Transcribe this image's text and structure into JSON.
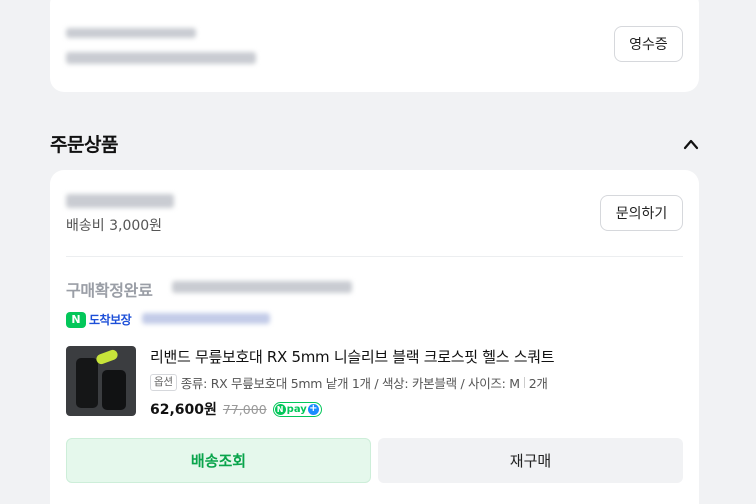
{
  "receipt_card": {
    "receipt_button": "영수증"
  },
  "section": {
    "title": "주문상품"
  },
  "order": {
    "shipping_fee": "배송비 3,000원",
    "inquiry_button": "문의하기",
    "status": "구매확정완료",
    "delivery_badge": {
      "n_mark": "N",
      "label": "도착보장"
    },
    "product": {
      "name": "리밴드 무릎보호대 RX 5mm 니슬리브 블랙 크로스핏 헬스 스쿼트",
      "option_tag": "옵션",
      "option_text": "종류: RX 무릎보호대 5mm 낱개 1개 / 색상: 카본블랙 / 사이즈: M",
      "quantity": "2개",
      "price": "62,600원",
      "original_price": "77,000",
      "npay": {
        "n": "N",
        "label": "pay",
        "plus": "+"
      }
    },
    "buttons": {
      "track": "배송조회",
      "reorder": "재구매"
    }
  },
  "colors": {
    "accent_green": "#03c75a",
    "track_text": "#09a44b",
    "badge_blue": "#1d4fd8"
  },
  "icons": {
    "collapse": "chevron-up-icon",
    "delivery_guarantee": "n-badge-icon",
    "npay": "npay-icon"
  }
}
